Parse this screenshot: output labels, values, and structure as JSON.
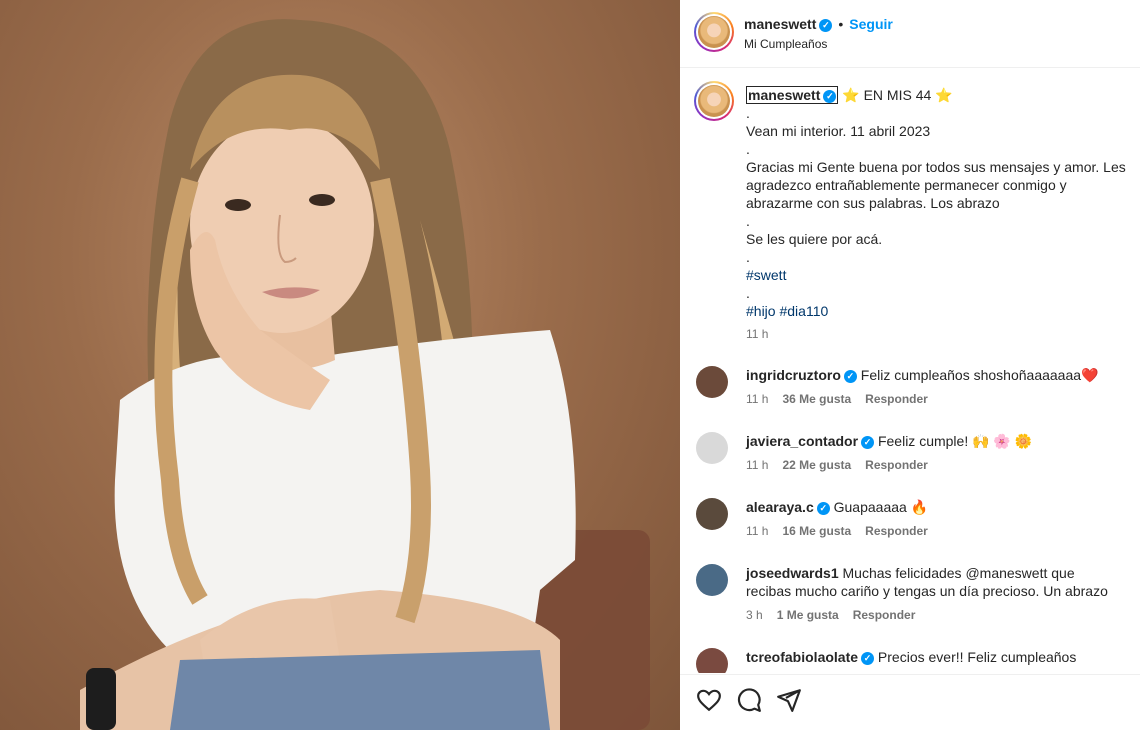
{
  "header": {
    "username": "maneswett",
    "verified_mark": "✓",
    "separator": "•",
    "follow_label": "Seguir",
    "subtitle": "Mi Cumpleaños"
  },
  "caption": {
    "username": "maneswett",
    "title": "⭐ EN MIS 44 ⭐",
    "lines": [
      ".",
      "Vean mi interior. 11 abril 2023",
      ".",
      "Gracias mi Gente buena por todos sus mensajes y amor. Les agradezco entrañablemente permanecer conmigo y abrazarme con sus palabras. Los abrazo",
      ".",
      "Se les quiere por acá.",
      "."
    ],
    "hashtag1": "#swett",
    "dot_after": ".",
    "hashtag2": "#hijo",
    "hashtag3": "#dia110",
    "time": "11 h"
  },
  "comments": [
    {
      "user": "ingridcruztoro",
      "verified": true,
      "text": "Feliz cumpleaños shoshoñaaaaaaa❤️",
      "time": "11 h",
      "likes": "36 Me gusta",
      "reply": "Responder",
      "avatar_color": "#6b4a3a"
    },
    {
      "user": "javiera_contador",
      "verified": true,
      "text": "Feeliz cumple! 🙌 🌸 🌼",
      "time": "11 h",
      "likes": "22 Me gusta",
      "reply": "Responder",
      "avatar_color": "#d9d9d9"
    },
    {
      "user": "alearaya.c",
      "verified": true,
      "text": "Guapaaaaa 🔥",
      "time": "11 h",
      "likes": "16 Me gusta",
      "reply": "Responder",
      "avatar_color": "#5a4a3c"
    },
    {
      "user": "joseedwards1",
      "verified": false,
      "text": "Muchas felicidades @maneswett que recibas mucho cariño y tengas un día precioso. Un abrazo",
      "time": "3 h",
      "likes": "1 Me gusta",
      "reply": "Responder",
      "avatar_color": "#4a6a86"
    },
    {
      "user": "tcreofabiolaolate",
      "verified": true,
      "text": "Precios ever!! Feliz cumpleaños",
      "time": "",
      "likes": "",
      "reply": "",
      "avatar_color": "#7a4a40"
    }
  ],
  "actions": {
    "like_icon": "heart-icon",
    "comment_icon": "comment-icon",
    "share_icon": "share-icon"
  }
}
